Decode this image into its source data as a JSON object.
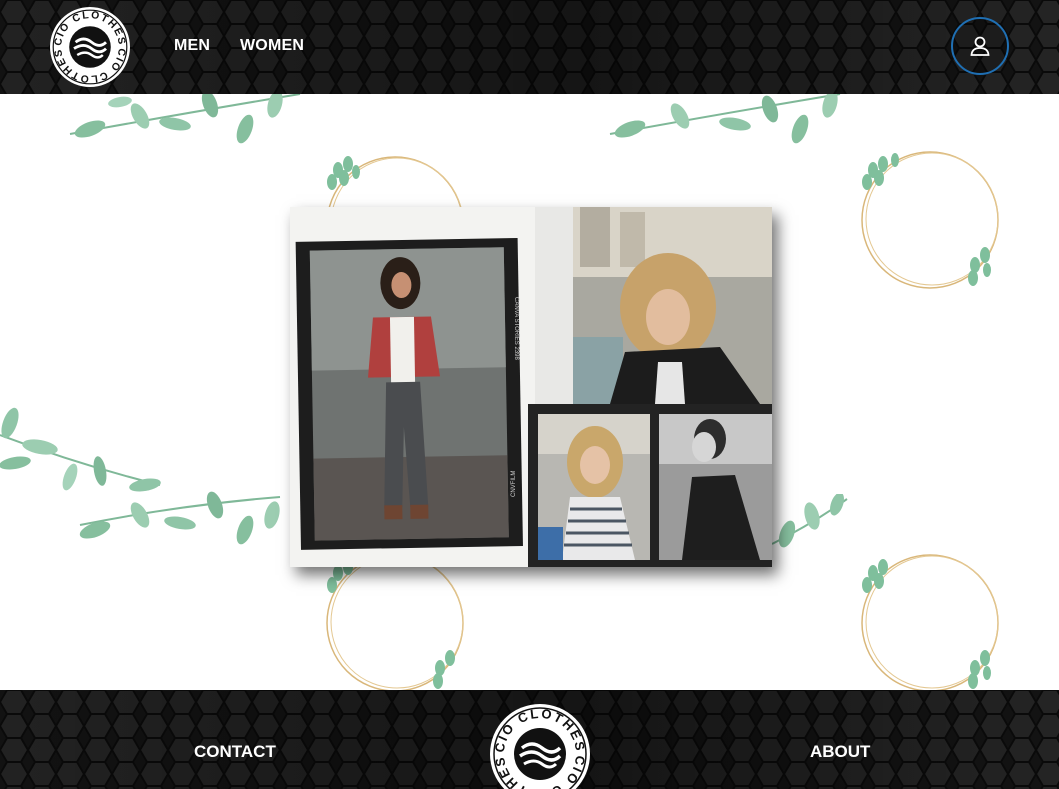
{
  "brand": {
    "name": "CIO CLOTHES"
  },
  "header": {
    "nav": [
      {
        "label": "MEN"
      },
      {
        "label": "WOMEN"
      }
    ]
  },
  "footer": {
    "contact_label": "CONTACT",
    "about_label": "ABOUT"
  },
  "icons": {
    "account": "user-icon"
  },
  "colors": {
    "bar_background": "#161616",
    "user_ring": "#1f6fb3",
    "leaf": "#8fc5a7",
    "gold_ring": "#d9b77a"
  },
  "hero": {
    "film_left_text": "CANVA STORIES 2398",
    "film_bottom_text": "CNVFILM"
  }
}
